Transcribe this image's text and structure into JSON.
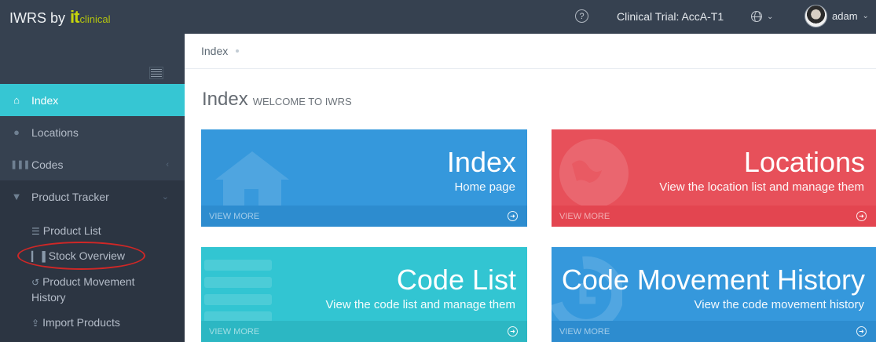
{
  "header": {
    "brand_name": "IWRS",
    "brand_by": "by",
    "brand_logo_it": "it",
    "brand_logo_clinical": "clinical",
    "help_symbol": "?",
    "help_icon": "question-circle-icon",
    "trial_label": "Clinical Trial: AccA-T1",
    "language_icon": "globe-icon",
    "username": "adam"
  },
  "sidebar": {
    "items": [
      {
        "label": "Index",
        "icon": "home-icon",
        "active": true
      },
      {
        "label": "Locations",
        "icon": "globe-icon"
      },
      {
        "label": "Codes",
        "icon": "barcode-icon"
      },
      {
        "label": "Product Tracker",
        "icon": "map-marker-icon",
        "expanded": true
      }
    ],
    "subitems": [
      {
        "label": "Product List",
        "icon": "list-icon"
      },
      {
        "label": "Stock Overview",
        "icon": "bar-chart-icon"
      },
      {
        "label": "Product Movement",
        "label2": "History",
        "icon": "history-icon"
      },
      {
        "label": "Import Products",
        "icon": "upload-icon"
      }
    ]
  },
  "breadcrumb": {
    "current": "Index"
  },
  "page": {
    "title": "Index",
    "subtitle": "WELCOME TO IWRS"
  },
  "tiles": [
    {
      "title": "Index",
      "description": "Home page",
      "more": "VIEW MORE",
      "color": "#3598dc",
      "icon": "home-icon"
    },
    {
      "title": "Locations",
      "description": "View the location list and manage them",
      "more": "VIEW MORE",
      "color": "#e7505a",
      "icon": "globe-icon"
    },
    {
      "title": "Code List",
      "description": "View the code list and manage them",
      "more": "VIEW MORE",
      "color": "#32c5d2",
      "icon": "list-icon"
    },
    {
      "title": "Code Movement History",
      "description": "View the code movement history",
      "more": "VIEW MORE",
      "color": "#3598dc",
      "icon": "history-icon"
    }
  ],
  "colors": {
    "topbar": "#364150",
    "sidebar": "#364150",
    "active": "#36c6d3",
    "highlight_circle": "#d02726"
  }
}
